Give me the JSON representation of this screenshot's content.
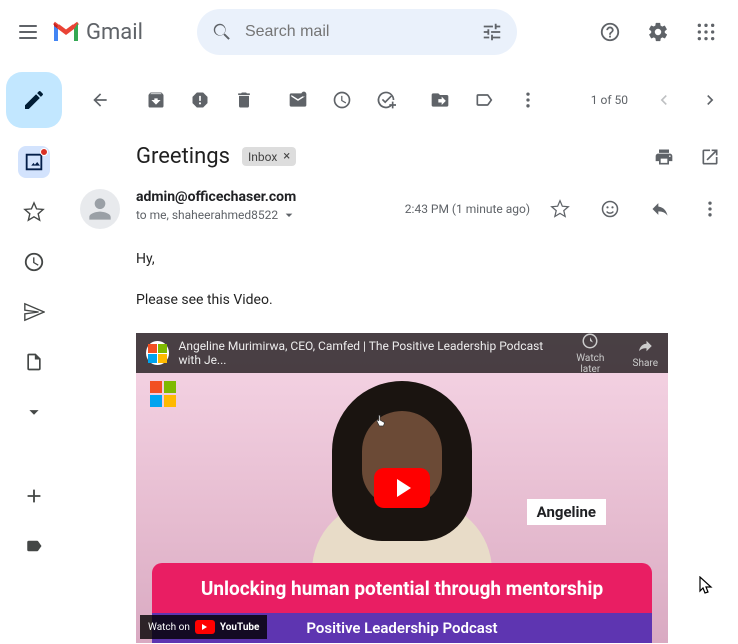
{
  "header": {
    "app_name": "Gmail",
    "search_placeholder": "Search mail"
  },
  "toolbar": {
    "counter": "1 of 50"
  },
  "subject": {
    "text": "Greetings",
    "label": "Inbox"
  },
  "sender": {
    "email": "admin@officechaser.com",
    "recipients_prefix": "to me, shaheerahmed8522",
    "time": "2:43 PM (1 minute ago)"
  },
  "body": {
    "line1": "Hy,",
    "line2": "Please see this Video."
  },
  "video": {
    "title": "Angeline Murimirwa, CEO, Camfed | The Positive Leadership Podcast with Je...",
    "watch_later": "Watch later",
    "share": "Share",
    "name_tag": "Angeline",
    "banner1": "Unlocking human potential through mentorship",
    "banner2": "Positive Leadership Podcast",
    "watch_on": "Watch on",
    "platform": "YouTube"
  }
}
